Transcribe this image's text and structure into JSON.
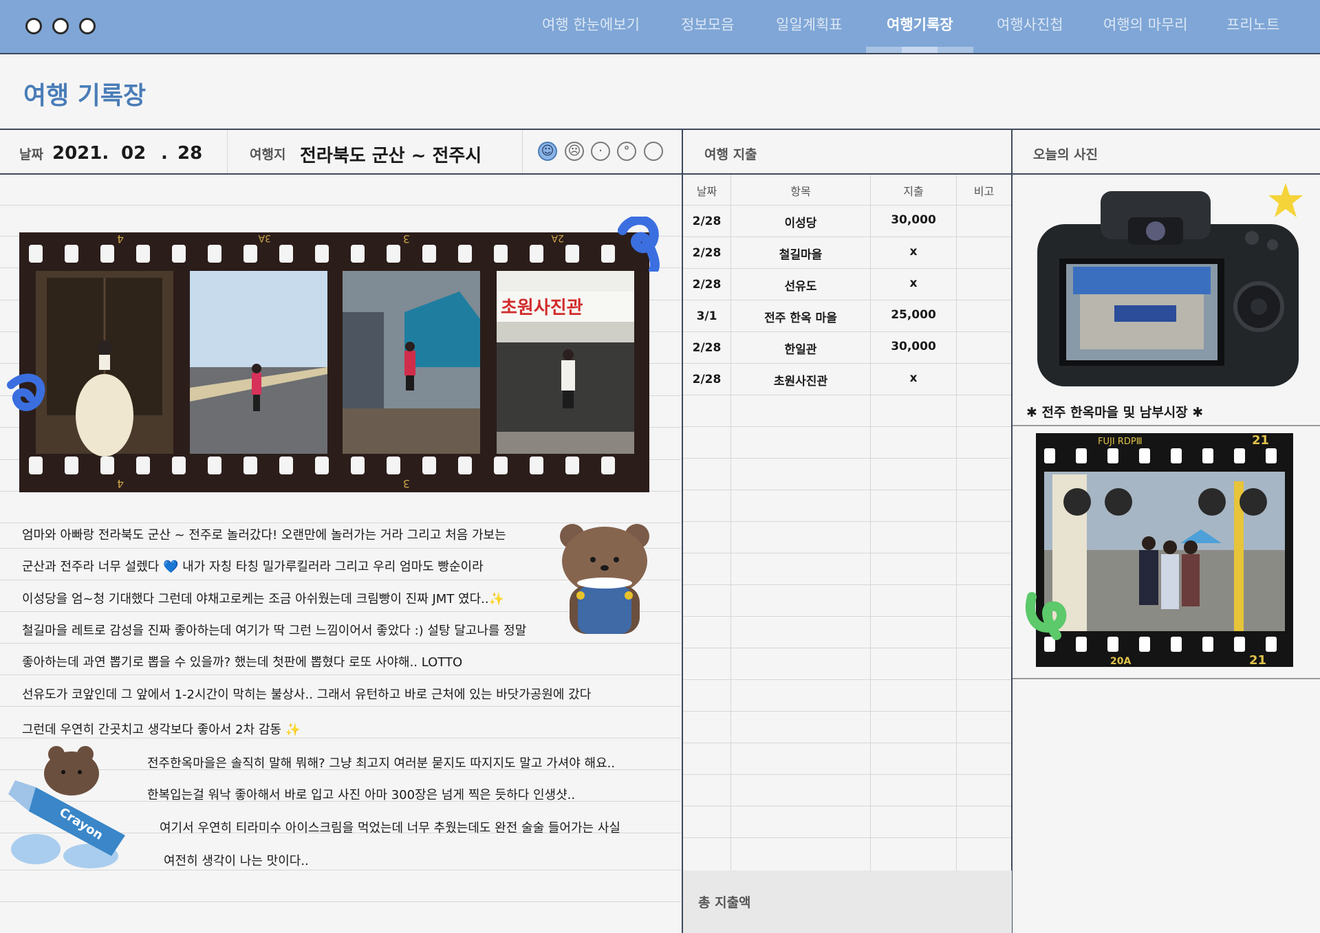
{
  "window": {
    "controls": [
      "close",
      "minimize",
      "maximize"
    ]
  },
  "nav": {
    "items": [
      "여행 한눈에보기",
      "정보모음",
      "일일계획표",
      "여행기록장",
      "여행사진첩",
      "여행의 마무리",
      "프리노트"
    ],
    "active": "여행기록장"
  },
  "page": {
    "title": "여행 기록장"
  },
  "entry": {
    "date_label": "날짜",
    "year": "2021.",
    "month": "02",
    "sep": ".",
    "day": "28",
    "destination_label": "여행지",
    "destination": "전라북도 군산 ~ 전주시",
    "mood_selected_index": 0
  },
  "film": {
    "frame_numbers": [
      "4",
      "3A",
      "3",
      "2A"
    ],
    "frame_numbers_bottom": [
      "4",
      "3"
    ]
  },
  "journal": {
    "lines": [
      "엄마와 아빠랑 전라북도 군산 ~ 전주로 놀러갔다!  오랜만에 놀러가는 거라 그리고 처음 가보는",
      "군산과 전주라 너무 설렜다 💙  내가 자칭 타칭 밀가루킬러라 그리고 우리 엄마도 빵순이라",
      "이성당을 엄~청 기대했다 그런데 야채고로케는 조금 아쉬웠는데 크림빵이 진짜 JMT 였다..✨",
      "철길마을 레트로 감성을 진짜 좋아하는데 여기가 딱 그런 느낌이어서 좋았다 :)  설탕 달고나를 정말",
      "좋아하는데 과연 뽑기로 뽑을 수 있을까? 했는데 첫판에 뽑혔다 로또 사야해.. LOTTO",
      "선유도가 코앞인데 그 앞에서 1-2시간이 막히는 불상사.. 그래서 유턴하고 바로 근처에 있는 바닷가공원에 갔다",
      "그런데 우연히 간곳치고 생각보다 좋아서 2차 감동 ✨",
      "전주한옥마을은 솔직히 말해 뭐해? 그냥 최고지 여러분 묻지도 따지지도 말고 가셔야 해요..",
      "한복입는걸 워낙 좋아해서 바로 입고 사진 아마 300장은 넘게 찍은 듯하다  인생샷..",
      "여기서 우연히 티라미수 아이스크림을 먹었는데 너무 추웠는데도 완전 술술 들어가는 사실",
      "여전히 생각이 나는 맛이다.."
    ]
  },
  "expenses": {
    "title": "여행 지출",
    "columns": [
      "날짜",
      "항목",
      "지출",
      "비고"
    ],
    "rows": [
      {
        "date": "2/28",
        "item": "이성당",
        "amount": "30,000",
        "note": ""
      },
      {
        "date": "2/28",
        "item": "철길마을",
        "amount": "x",
        "note": ""
      },
      {
        "date": "2/28",
        "item": "선유도",
        "amount": "x",
        "note": ""
      },
      {
        "date": "3/1",
        "item": "전주 한옥 마을",
        "amount": "25,000",
        "note": ""
      },
      {
        "date": "2/28",
        "item": "한일관",
        "amount": "30,000",
        "note": ""
      },
      {
        "date": "2/28",
        "item": "초원사진관",
        "amount": "x",
        "note": ""
      }
    ],
    "total_label": "총 지출액"
  },
  "photo": {
    "title": "오늘의 사진",
    "caption": "✱ 전주 한옥마을 및 남부시장 ✱",
    "film_brand": "FUJI  RDPⅢ",
    "film_frame_top": "21",
    "film_frame_bottom": "21",
    "film_frame_code": "20A",
    "shop_sign": "초원사진관"
  },
  "colors": {
    "accent": "#7fa6d6",
    "title": "#4a7db8",
    "border": "#3e4a5c"
  }
}
